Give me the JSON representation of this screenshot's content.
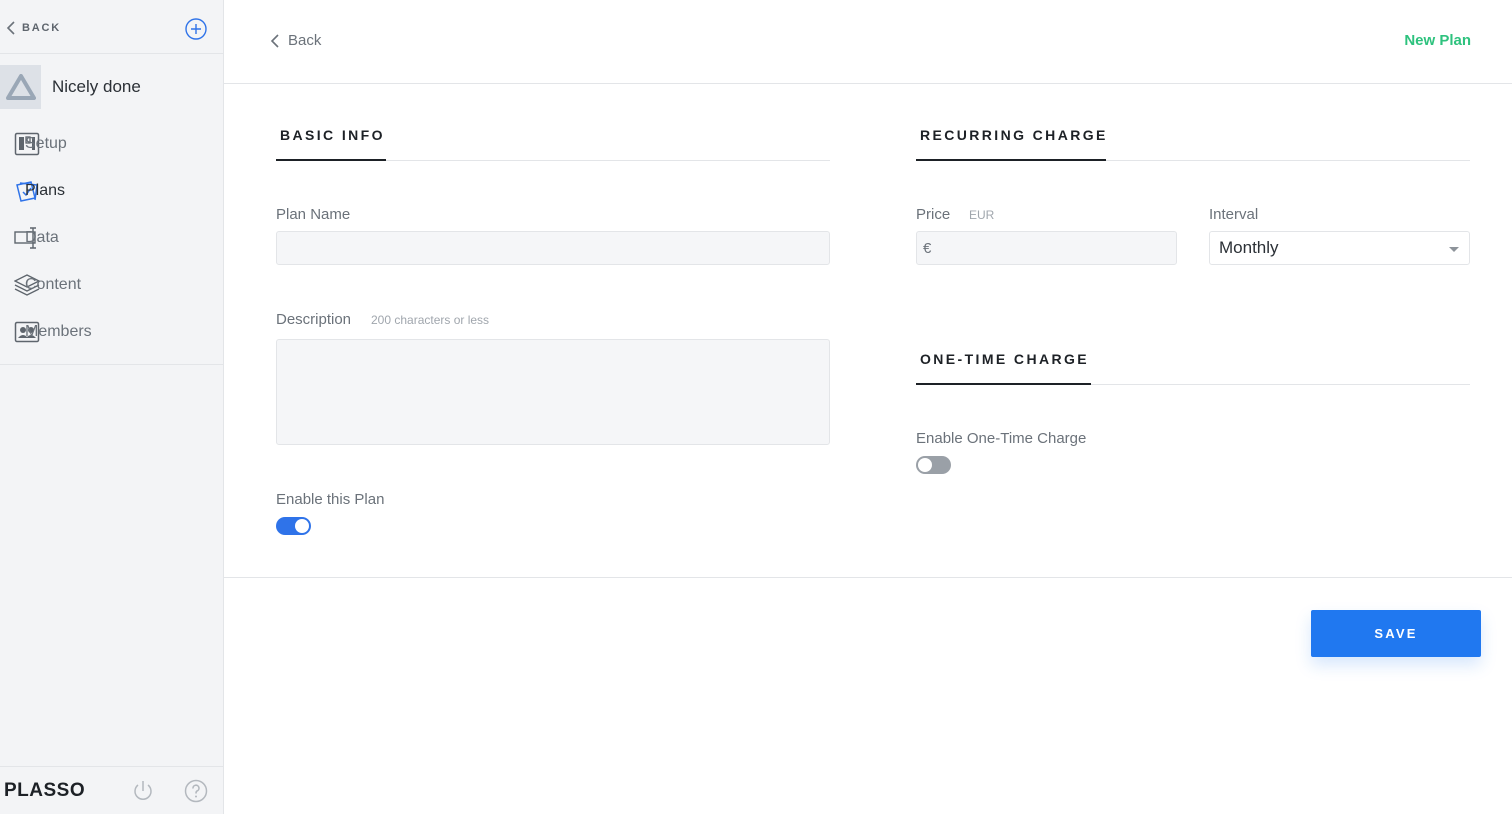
{
  "sidebar": {
    "back_label": "BACK",
    "org_name": "Nicely done",
    "items": [
      {
        "label": "Setup",
        "icon": "setup-icon"
      },
      {
        "label": "Plans",
        "icon": "plans-icon",
        "active": true
      },
      {
        "label": "Data",
        "icon": "data-icon"
      },
      {
        "label": "Content",
        "icon": "content-icon"
      },
      {
        "label": "Members",
        "icon": "members-icon"
      }
    ],
    "brand": "PLASSO"
  },
  "header": {
    "back_label": "Back",
    "title": "New Plan",
    "title_color": "#2ec27e"
  },
  "basic_info": {
    "title": "BASIC INFO",
    "plan_name_label": "Plan Name",
    "plan_name_value": "",
    "description_label": "Description",
    "description_hint": "200 characters or less",
    "description_value": "",
    "enable_label": "Enable this Plan",
    "enabled": true
  },
  "recurring": {
    "title": "RECURRING CHARGE",
    "price_label": "Price",
    "price_currency": "EUR",
    "price_symbol": "€",
    "price_value": "",
    "interval_label": "Interval",
    "interval_value": "Monthly"
  },
  "one_time": {
    "title": "ONE-TIME CHARGE",
    "enable_label": "Enable One-Time Charge",
    "enabled": false
  },
  "actions": {
    "save_label": "SAVE",
    "accent_color": "#2078f0"
  }
}
